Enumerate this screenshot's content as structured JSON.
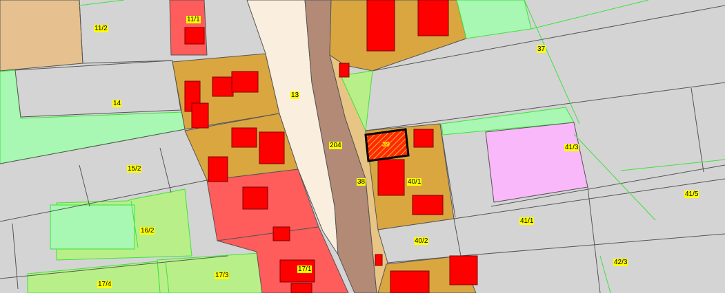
{
  "map": {
    "colors": {
      "base_gray": "#d4d4d4",
      "parcel_border": "#555555",
      "green_line": "#3ce23c",
      "residential_orange": "#d9a640",
      "building_red": "#ff0000",
      "zone_salmon": "#ff5c5c",
      "road_brown": "#b38a76",
      "road_cream": "#faefdf",
      "road_tan": "#e8c585",
      "tan_parcel": "#e6c08e",
      "mint_green": "#a8f7b3",
      "light_green": "#b9ef88",
      "pink_parcel": "#f9b8f9",
      "label_bg": "#ffff00",
      "selected_outline": "#000000"
    },
    "parcel_labels": {
      "p11_1": "11/1",
      "p11_2": "11/2",
      "p37": "37",
      "p13": "13",
      "p14": "14",
      "p204": "204",
      "p39": "39",
      "p41_3": "41/3",
      "p15_2": "15/2",
      "p38": "38",
      "p40_1": "40/1",
      "p41_5": "41/5",
      "p16_2": "16/2",
      "p41_1": "41/1",
      "p40_2": "40/2",
      "p17_1": "17/1",
      "p42_3": "42/3",
      "p17_3": "17/3",
      "p17_4": "17/4"
    },
    "selected_parcel": "39"
  }
}
